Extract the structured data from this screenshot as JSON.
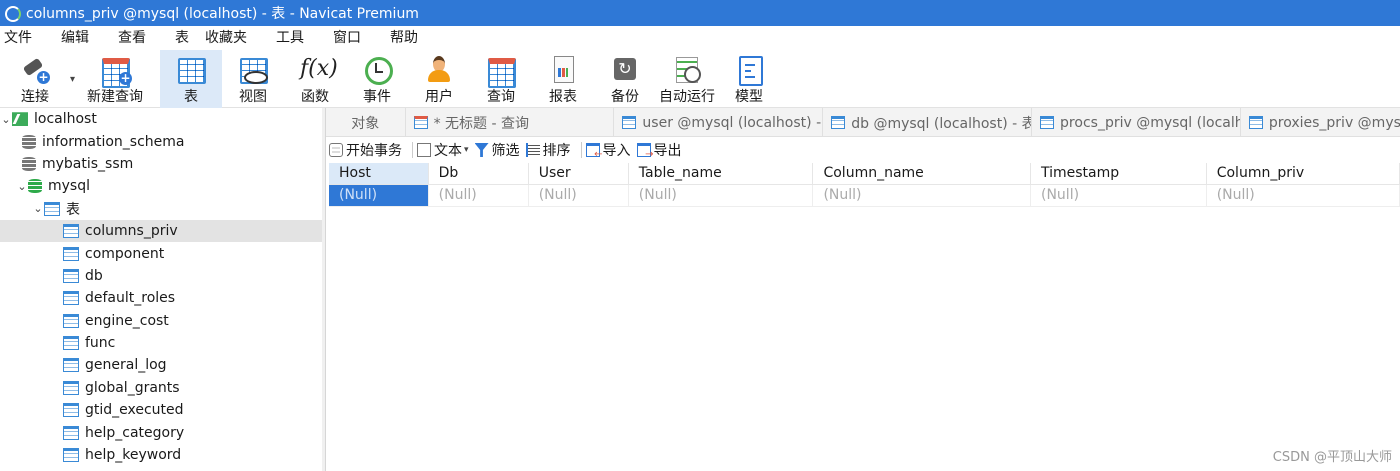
{
  "window": {
    "title": "columns_priv @mysql (localhost) - 表 - Navicat Premium"
  },
  "menu": [
    "文件",
    "编辑",
    "查看",
    "表",
    "收藏夹",
    "工具",
    "窗口",
    "帮助"
  ],
  "toolbar": {
    "connect": "连接",
    "new_query": "新建查询",
    "table": "表",
    "view": "视图",
    "function": "函数",
    "event": "事件",
    "user": "用户",
    "query": "查询",
    "report": "报表",
    "backup": "备份",
    "automation": "自动运行",
    "model": "模型",
    "function_glyph": "f(x)"
  },
  "tree": {
    "connection": "localhost",
    "databases": [
      "information_schema",
      "mybatis_ssm"
    ],
    "open_db": "mysql",
    "tables_node": "表",
    "tables": [
      "columns_priv",
      "component",
      "db",
      "default_roles",
      "engine_cost",
      "func",
      "general_log",
      "global_grants",
      "gtid_executed",
      "help_category",
      "help_keyword"
    ]
  },
  "tabs": {
    "objects": "对象",
    "untitled_query": "* 无标题 - 查询",
    "user": "user @mysql (localhost) - ...",
    "db": "db @mysql (localhost) - 表",
    "procs_priv": "procs_priv @mysql (localh...",
    "proxies_priv": "proxies_priv @mysq"
  },
  "subtoolbar": {
    "begin_transaction": "开始事务",
    "text": "文本",
    "filter": "筛选",
    "sort": "排序",
    "import": "导入",
    "export": "导出"
  },
  "grid": {
    "columns": [
      "Host",
      "Db",
      "User",
      "Table_name",
      "Column_name",
      "Timestamp",
      "Column_priv"
    ],
    "row": [
      "(Null)",
      "(Null)",
      "(Null)",
      "(Null)",
      "(Null)",
      "(Null)",
      "(Null)"
    ]
  },
  "watermark": "CSDN @平顶山大师"
}
